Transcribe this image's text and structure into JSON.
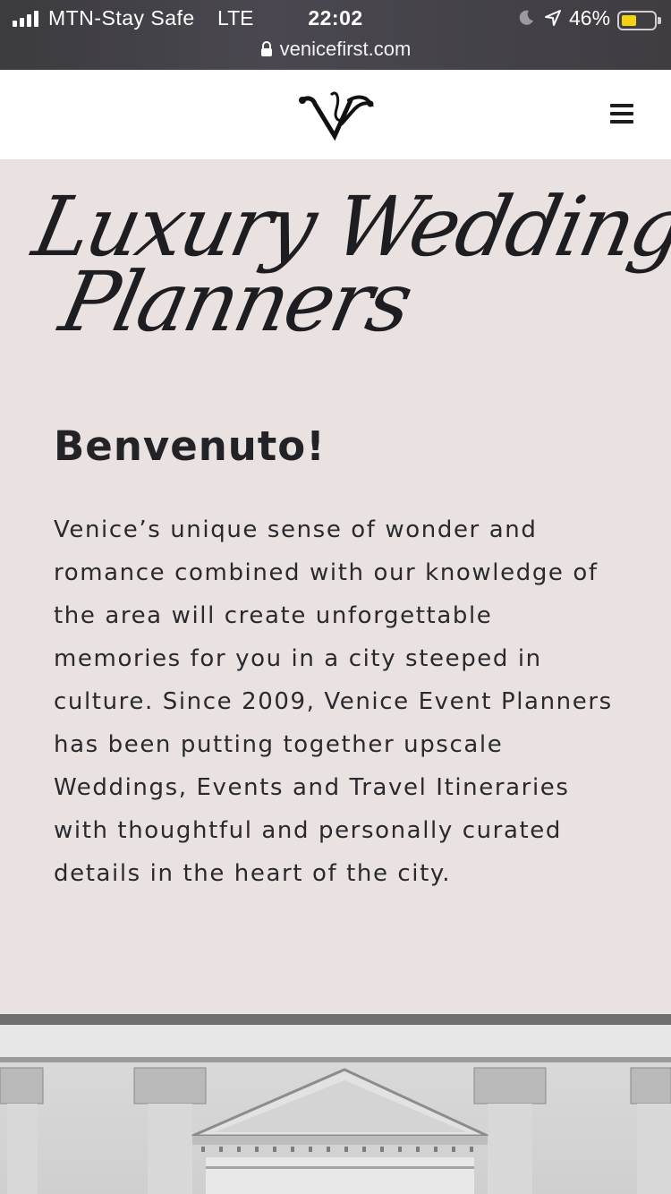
{
  "status_bar": {
    "carrier": "MTN-Stay Safe",
    "network": "LTE",
    "time": "22:02",
    "battery_percent": "46%",
    "battery_level": 0.46,
    "battery_color": "#f5d20f"
  },
  "browser": {
    "url": "venicefirst.com"
  },
  "header": {
    "logo_text": "VF",
    "menu_icon": "hamburger-menu-icon"
  },
  "hero": {
    "script_title_line1": "Luxury Wedding",
    "script_title_line2": "Planners"
  },
  "intro": {
    "heading": "Benvenuto!",
    "body": "Venice’s unique sense of wonder and romance combined with our knowledge of the area will create unforgettable memories for you in a city steeped in culture. Since 2009, Venice Event Planners has been putting together upscale Weddings, Events and Travel Itineraries with thoughtful and personally curated details in the heart of the city."
  },
  "colors": {
    "background": "#e9e2e1",
    "text": "#232226",
    "header_bg": "#ffffff"
  }
}
